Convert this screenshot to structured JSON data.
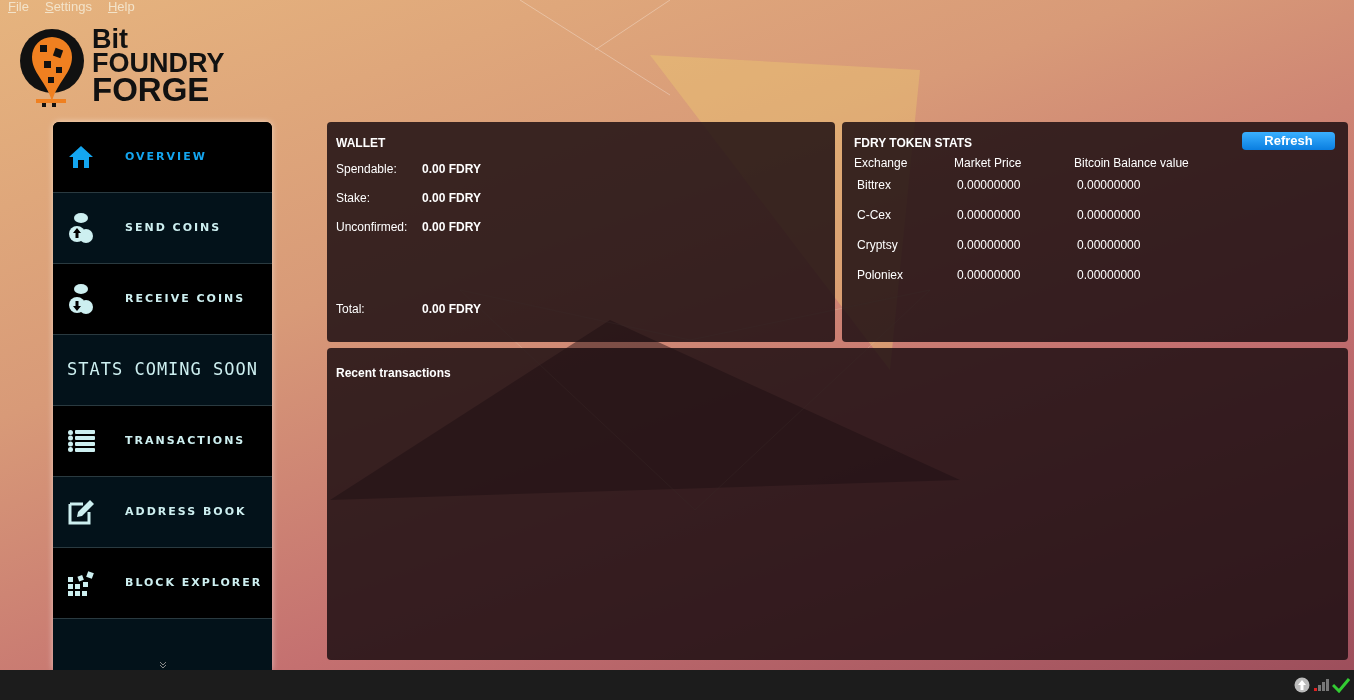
{
  "menu": [
    {
      "label": "File"
    },
    {
      "label": "Settings"
    },
    {
      "label": "Help"
    }
  ],
  "logo": {
    "line1": "Bit",
    "line2": "FOUNDRY",
    "line3": "FORGE"
  },
  "nav": [
    {
      "kind": "nav",
      "label": "OVERVIEW",
      "selected": true
    },
    {
      "kind": "nav",
      "label": "SEND COINS",
      "selected": false
    },
    {
      "kind": "nav",
      "label": "RECEIVE COINS",
      "selected": false
    },
    {
      "kind": "banner",
      "label": "STATS COMING SOON",
      "selected": false
    },
    {
      "kind": "nav",
      "label": "TRANSACTIONS",
      "selected": false
    },
    {
      "kind": "nav",
      "label": "ADDRESS BOOK",
      "selected": false
    },
    {
      "kind": "nav",
      "label": "BLOCK EXPLORER",
      "selected": false
    }
  ],
  "wallet": {
    "title": "WALLET",
    "rows": [
      {
        "label": "Spendable:",
        "value": "0.00 FDRY"
      },
      {
        "label": "Stake:",
        "value": "0.00 FDRY"
      },
      {
        "label": "Unconfirmed:",
        "value": "0.00 FDRY"
      }
    ],
    "total": {
      "label": "Total:",
      "value": "0.00 FDRY"
    }
  },
  "stats": {
    "title": "FDRY TOKEN STATS",
    "refresh": "Refresh",
    "columns": [
      "Exchange",
      "Market Price",
      "Bitcoin Balance value"
    ],
    "rows": [
      [
        "Bittrex",
        "0.00000000",
        "0.00000000"
      ],
      [
        "C-Cex",
        "0.00000000",
        "0.00000000"
      ],
      [
        "Cryptsy",
        "0.00000000",
        "0.00000000"
      ],
      [
        "Poloniex",
        "0.00000000",
        "0.00000000"
      ]
    ]
  },
  "recent": {
    "title": "Recent transactions"
  }
}
